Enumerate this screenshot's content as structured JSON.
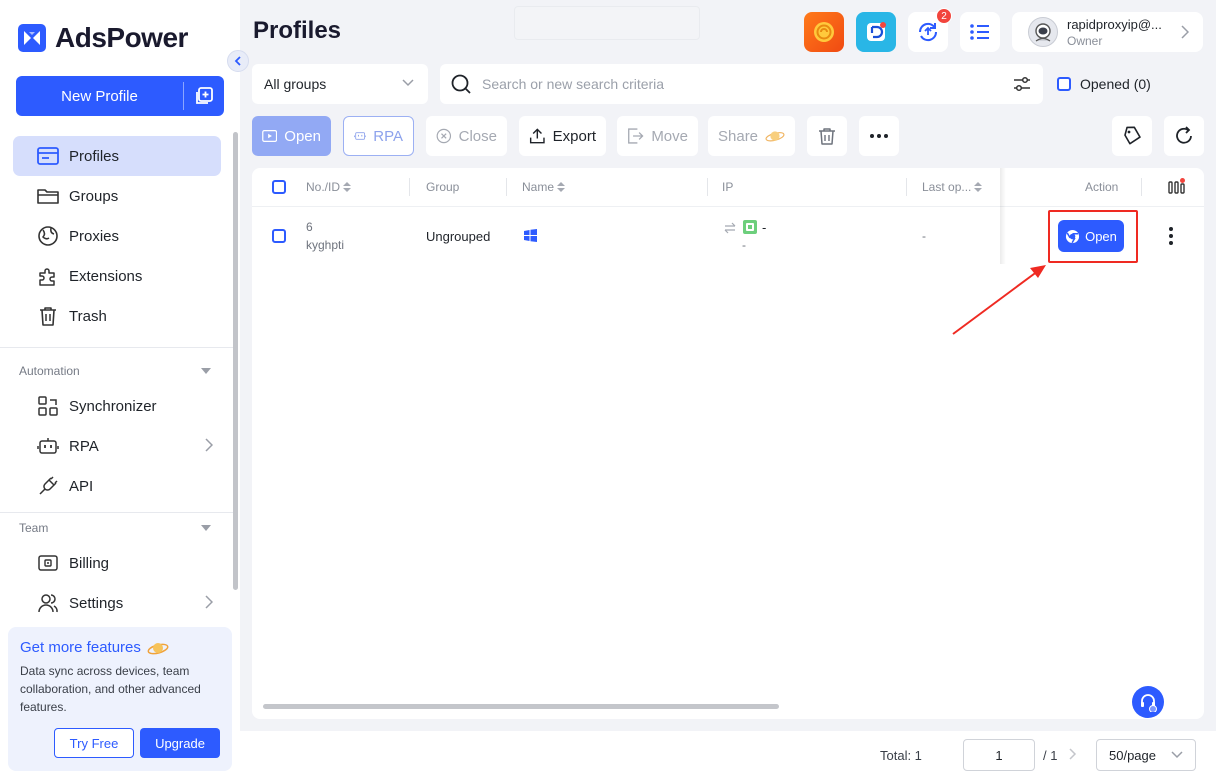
{
  "app": {
    "brand": "AdsPower",
    "page_title": "Profiles",
    "brand_color": "#2d5bff"
  },
  "sidebar": {
    "new_profile_label": "New Profile",
    "main_items": [
      {
        "label": "Profiles",
        "icon": "profiles-icon",
        "active": true
      },
      {
        "label": "Groups",
        "icon": "folder-icon"
      },
      {
        "label": "Proxies",
        "icon": "globe-icon"
      },
      {
        "label": "Extensions",
        "icon": "puzzle-icon"
      },
      {
        "label": "Trash",
        "icon": "trash-icon"
      }
    ],
    "automation_label": "Automation",
    "automation_items": [
      {
        "label": "Synchronizer",
        "icon": "synchronizer-icon"
      },
      {
        "label": "RPA",
        "icon": "robot-icon"
      },
      {
        "label": "API",
        "icon": "plug-icon"
      }
    ],
    "team_label": "Team",
    "team_items": [
      {
        "label": "Billing",
        "icon": "wallet-icon"
      },
      {
        "label": "Settings",
        "icon": "users-icon"
      }
    ],
    "promo": {
      "title": "Get more features",
      "text": "Data sync across devices, team collaboration, and other advanced features.",
      "try_label": "Try Free",
      "upgrade_label": "Upgrade"
    }
  },
  "header": {
    "notification_count": "2",
    "user_name": "rapidproxyip@...",
    "user_role": "Owner"
  },
  "filters": {
    "group_select": "All groups",
    "search_placeholder": "Search or new search criteria",
    "opened_label": "Opened (0)"
  },
  "toolbar": {
    "open": "Open",
    "rpa": "RPA",
    "close": "Close",
    "export": "Export",
    "move": "Move",
    "share": "Share"
  },
  "table": {
    "columns": [
      "No./ID",
      "Group",
      "Name",
      "IP",
      "Last op...",
      "Action"
    ],
    "rows": [
      {
        "no": "6",
        "id": "kyghpti",
        "group": "Ungrouped",
        "ip_value": "-",
        "ip_sub": "-",
        "last_op": "-",
        "action_label": "Open"
      }
    ]
  },
  "pagination": {
    "total": "Total: 1",
    "current_page": "1",
    "of_pages": "/ 1",
    "page_size": "50/page"
  }
}
